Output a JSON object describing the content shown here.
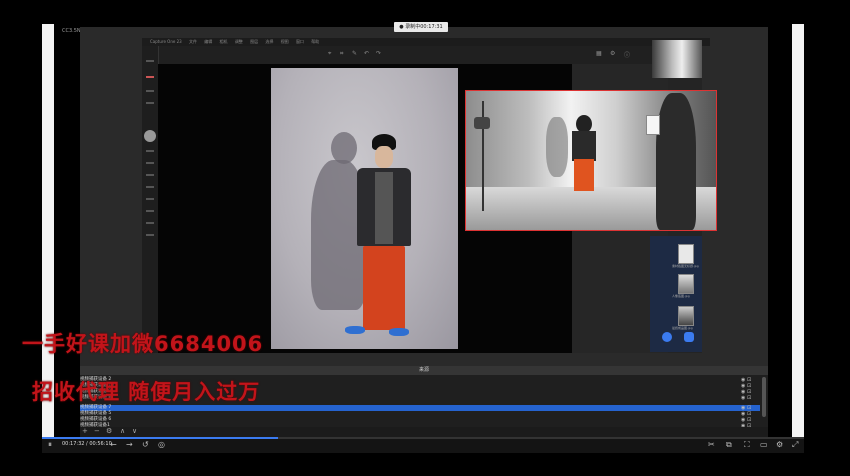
{
  "recording": {
    "label": "● 录制中00:17:31"
  },
  "side_label": "CC3.5N",
  "app": {
    "title": "Capture One 23",
    "menu": [
      "Capture One 23",
      "文件",
      "编辑",
      "相机",
      "调整",
      "图层",
      "选择",
      "视图",
      "窗口",
      "帮助"
    ],
    "thumb_captions": [
      "素材截图无标题.jpg",
      "人像底图.jpg",
      "最终成品图.jpg"
    ]
  },
  "scenes": {
    "label": "来源"
  },
  "sources": [
    {
      "name": "视频捕获设备 2"
    },
    {
      "name": "视频捕获设备 10"
    },
    {
      "name": "视频捕获设备 9"
    },
    {
      "name": "视频捕获设备 8"
    },
    {
      "name": "视频捕获设备 7",
      "selected": true
    },
    {
      "name": "视频捕获设备 5"
    },
    {
      "name": "视频捕获设备 6"
    },
    {
      "name": "视频捕获设备1"
    }
  ],
  "source_controls": [
    "+",
    "−",
    "⚙",
    "∧",
    "∨"
  ],
  "timebar": {
    "time": "00:17:32 / 00:56:10"
  },
  "watermark": {
    "line1": "一手好课加微6684006",
    "line2": "招收代理 随便月入过万"
  },
  "colors": {
    "selected_row": "#2563cf",
    "watermark": "#c2141a",
    "webcam_border": "#dd3333"
  }
}
